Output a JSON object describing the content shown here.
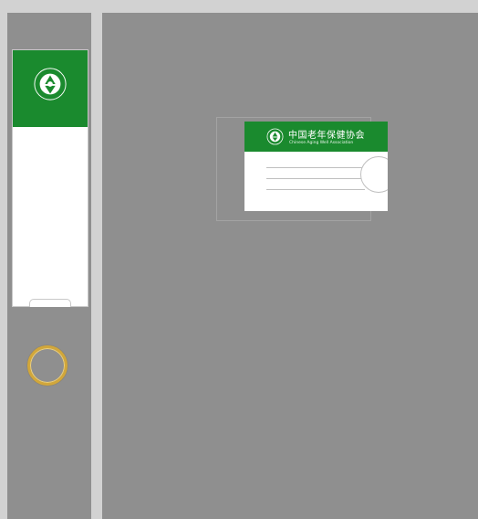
{
  "spine": {
    "emblem_text": "中国老年保健协会",
    "colors": {
      "band": "#1a8a2e",
      "ring": "#d2a73a",
      "panel": "#8f8f8f"
    }
  },
  "label_card": {
    "title": "中国老年保健协会",
    "subtitle": "Chinese Aging Well Association",
    "colors": {
      "header": "#1a8a2e",
      "body": "#ffffff"
    }
  }
}
